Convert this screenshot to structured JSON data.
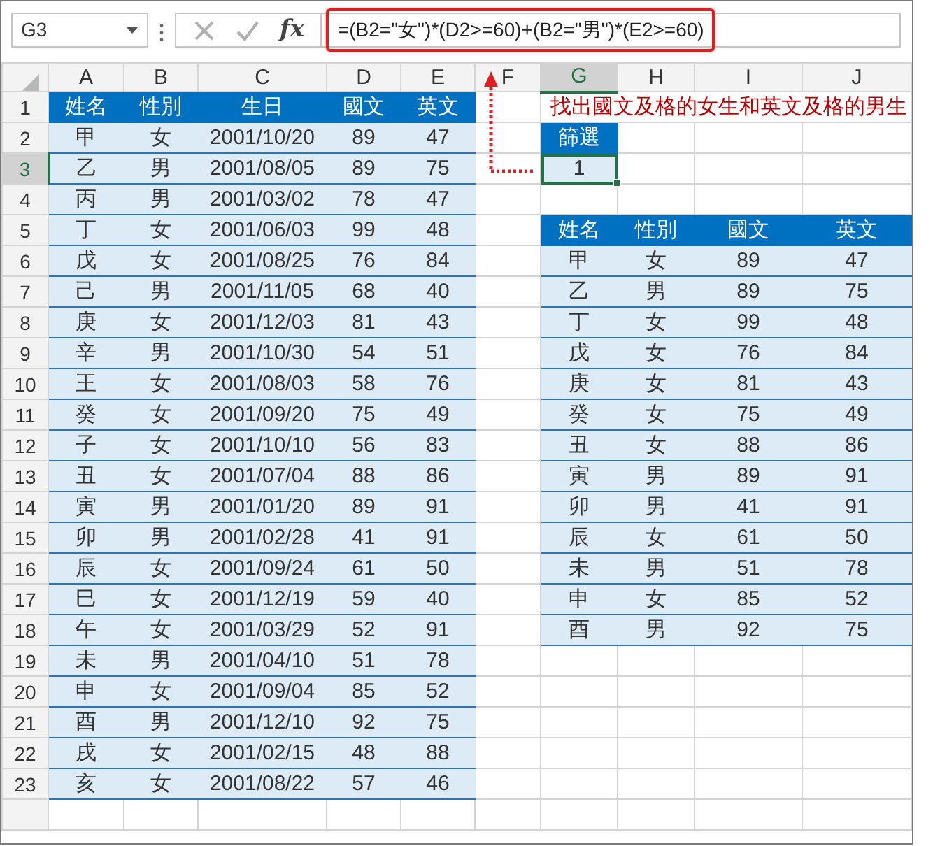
{
  "name_box": "G3",
  "function_label": "fx",
  "formula": "=(B2=\"女\")*(D2>=60)+(B2=\"男\")*(E2>=60)",
  "column_letters": [
    "A",
    "B",
    "C",
    "D",
    "E",
    "F",
    "G",
    "H",
    "I",
    "J"
  ],
  "row_numbers": [
    "1",
    "2",
    "3",
    "4",
    "5",
    "6",
    "7",
    "8",
    "9",
    "10",
    "11",
    "12",
    "13",
    "14",
    "15",
    "16",
    "17",
    "18",
    "19",
    "20",
    "21",
    "22",
    "23"
  ],
  "student_table": {
    "columns": [
      "姓名",
      "性別",
      "生日",
      "國文",
      "英文"
    ],
    "rows": [
      [
        "甲",
        "女",
        "2001/10/20",
        "89",
        "47"
      ],
      [
        "乙",
        "男",
        "2001/08/05",
        "89",
        "75"
      ],
      [
        "丙",
        "男",
        "2001/03/02",
        "78",
        "47"
      ],
      [
        "丁",
        "女",
        "2001/06/03",
        "99",
        "48"
      ],
      [
        "戊",
        "女",
        "2001/08/25",
        "76",
        "84"
      ],
      [
        "己",
        "男",
        "2001/11/05",
        "68",
        "40"
      ],
      [
        "庚",
        "女",
        "2001/12/03",
        "81",
        "43"
      ],
      [
        "辛",
        "男",
        "2001/10/30",
        "54",
        "51"
      ],
      [
        "王",
        "女",
        "2001/08/03",
        "58",
        "76"
      ],
      [
        "癸",
        "女",
        "2001/09/20",
        "75",
        "49"
      ],
      [
        "子",
        "女",
        "2001/10/10",
        "56",
        "83"
      ],
      [
        "丑",
        "女",
        "2001/07/04",
        "88",
        "86"
      ],
      [
        "寅",
        "男",
        "2001/01/20",
        "89",
        "91"
      ],
      [
        "卯",
        "男",
        "2001/02/28",
        "41",
        "91"
      ],
      [
        "辰",
        "女",
        "2001/09/24",
        "61",
        "50"
      ],
      [
        "巳",
        "女",
        "2001/12/19",
        "59",
        "40"
      ],
      [
        "午",
        "女",
        "2001/03/29",
        "52",
        "91"
      ],
      [
        "未",
        "男",
        "2001/04/10",
        "51",
        "78"
      ],
      [
        "申",
        "女",
        "2001/09/04",
        "85",
        "52"
      ],
      [
        "酉",
        "男",
        "2001/12/10",
        "92",
        "75"
      ],
      [
        "戌",
        "女",
        "2001/02/15",
        "48",
        "88"
      ],
      [
        "亥",
        "女",
        "2001/08/22",
        "57",
        "46"
      ]
    ]
  },
  "note": "找出國文及格的女生和英文及格的男生",
  "filter": {
    "header": "篩選",
    "value": "1",
    "selected": true
  },
  "result_table": {
    "columns": [
      "姓名",
      "性別",
      "國文",
      "英文"
    ],
    "rows": [
      [
        "甲",
        "女",
        "89",
        "47"
      ],
      [
        "乙",
        "男",
        "89",
        "75"
      ],
      [
        "丁",
        "女",
        "99",
        "48"
      ],
      [
        "戊",
        "女",
        "76",
        "84"
      ],
      [
        "庚",
        "女",
        "81",
        "43"
      ],
      [
        "癸",
        "女",
        "75",
        "49"
      ],
      [
        "丑",
        "女",
        "88",
        "86"
      ],
      [
        "寅",
        "男",
        "89",
        "91"
      ],
      [
        "卯",
        "男",
        "41",
        "91"
      ],
      [
        "辰",
        "女",
        "61",
        "50"
      ],
      [
        "未",
        "男",
        "51",
        "78"
      ],
      [
        "申",
        "女",
        "85",
        "52"
      ],
      [
        "酉",
        "男",
        "92",
        "75"
      ]
    ]
  }
}
